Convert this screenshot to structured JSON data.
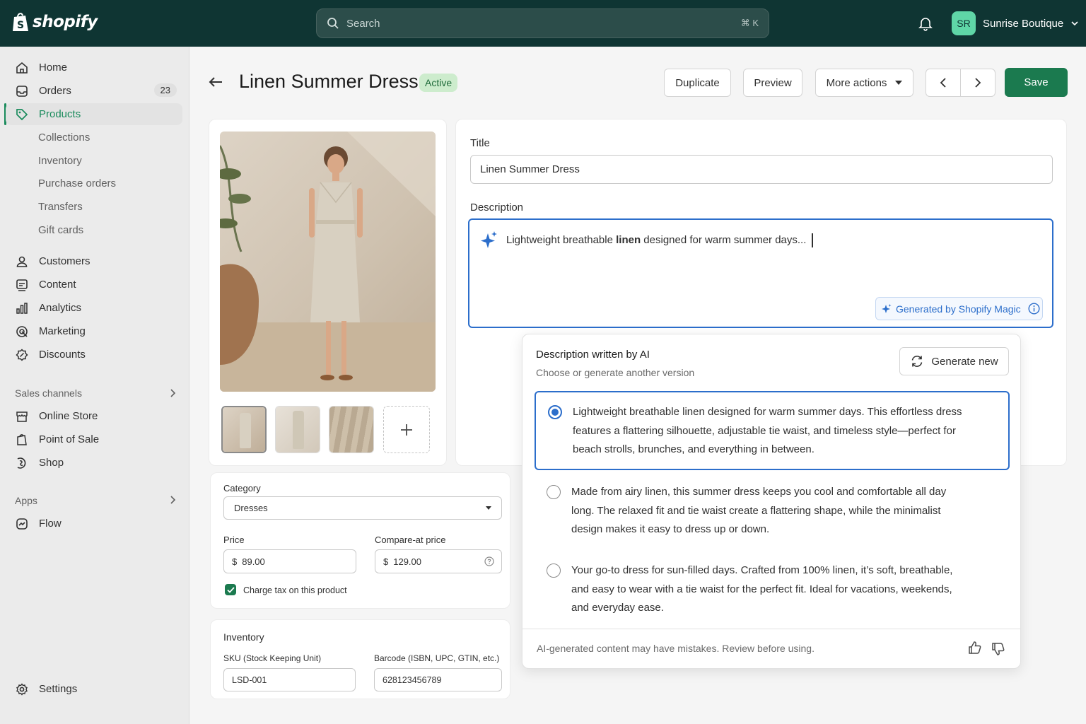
{
  "topbar": {
    "brand": "shopify",
    "search_placeholder": "Search",
    "search_shortcut": "⌘ K",
    "store_initials": "SR",
    "store_name": "Sunrise Boutique"
  },
  "sidebar": {
    "items": [
      {
        "label": "Home",
        "icon": "home-icon"
      },
      {
        "label": "Orders",
        "icon": "inbox-icon",
        "badge": "23"
      },
      {
        "label": "Products",
        "icon": "tag-icon"
      },
      {
        "label": "Customers",
        "icon": "person-icon"
      },
      {
        "label": "Content",
        "icon": "content-icon"
      },
      {
        "label": "Analytics",
        "icon": "bar-chart-icon"
      },
      {
        "label": "Marketing",
        "icon": "target-icon"
      },
      {
        "label": "Discounts",
        "icon": "discount-icon"
      }
    ],
    "product_subitems": [
      "Collections",
      "Inventory",
      "Purchase orders",
      "Transfers",
      "Gift cards"
    ],
    "sales_channels_label": "Sales channels",
    "sales_channels": [
      {
        "label": "Online Store",
        "icon": "store-icon"
      },
      {
        "label": "Point of Sale",
        "icon": "pos-icon"
      },
      {
        "label": "Shop",
        "icon": "shop-icon"
      }
    ],
    "apps_label": "Apps",
    "apps": [
      {
        "label": "Flow",
        "icon": "flow-icon"
      }
    ],
    "settings_label": "Settings"
  },
  "header": {
    "title": "Linen Summer Dress",
    "status": "Active",
    "duplicate": "Duplicate",
    "preview": "Preview",
    "more_actions": "More actions",
    "save": "Save"
  },
  "form": {
    "title_label": "Title",
    "title_value": "Linen Summer Dress",
    "description_label": "Description",
    "description_prefix": "Lightweight breathable ",
    "description_bold": "linen",
    "description_suffix": " designed for warm summer days...",
    "magic_label": "Generated by Shopify Magic"
  },
  "ai": {
    "title": "Description written by AI",
    "subtitle": "Choose or generate another version",
    "generate_new": "Generate new",
    "options": [
      "Lightweight breathable linen designed for warm summer days. This effortless dress features a flattering silhouette, adjustable tie waist, and timeless style—perfect for beach strolls, brunches, and everything in between.",
      "Made from airy linen, this summer dress keeps you cool and comfortable all day long. The relaxed fit and tie waist create a flattering shape, while the minimalist design makes it easy to dress up or down.",
      "Your go-to dress for sun-filled days. Crafted from 100% linen, it’s soft, breathable, and easy to wear with a tie waist for the perfect fit. Ideal for vacations, weekends, and everyday ease."
    ],
    "selected_index": 0,
    "disclaimer": "AI-generated content may have mistakes. Review before using."
  },
  "pricing": {
    "category_label": "Category",
    "category_value": "Dresses",
    "price_label": "Price",
    "price_currency": "$",
    "price_value": "89.00",
    "compare_label": "Compare-at price",
    "compare_currency": "$",
    "compare_value": "129.00",
    "charge_tax_label": "Charge tax on this product",
    "charge_tax": true
  },
  "inventory": {
    "title": "Inventory",
    "sku_label": "SKU (Stock Keeping Unit)",
    "sku_value": "LSD-001",
    "barcode_label": "Barcode (ISBN, UPC, GTIN, etc.)",
    "barcode_value": "628123456789"
  },
  "colors": {
    "topbar": "#0f3533",
    "accent_green": "#1b7a4f",
    "focus_blue": "#2c6ecb"
  }
}
